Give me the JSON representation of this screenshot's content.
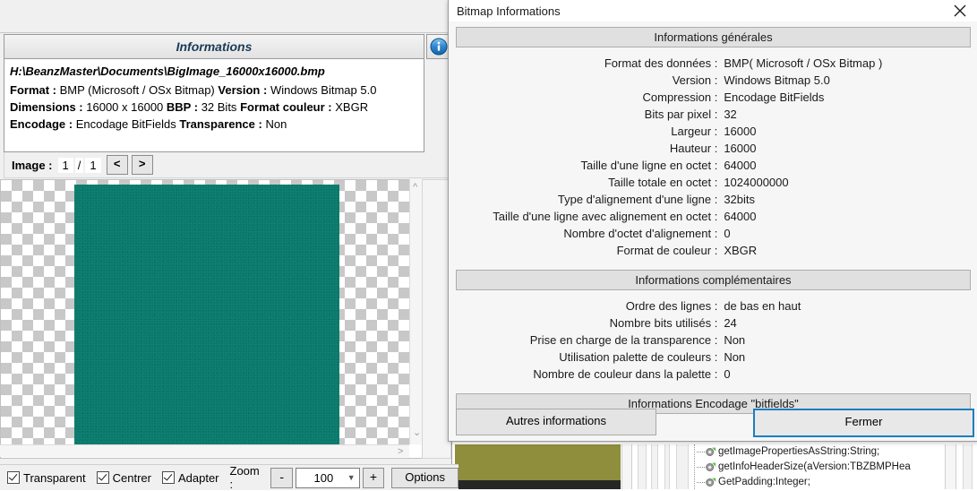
{
  "background": {
    "code_tree": [
      "getImagePropertiesAsString:String;",
      "getInfoHeaderSize(aVersion:TBZBMPHea",
      "GetPadding:Integer;"
    ]
  },
  "main_window": {
    "info_panel": {
      "title": "Informations",
      "file_path": "H:\\BeanzMaster\\Documents\\BigImage_16000x16000.bmp",
      "lines": [
        [
          {
            "k": "Format :",
            "v": "BMP (Microsoft / OSx Bitmap)"
          },
          {
            "k": "Version :",
            "v": "Windows Bitmap 5.0"
          }
        ],
        [
          {
            "k": "Dimensions :",
            "v": "16000 x 16000"
          },
          {
            "k": "BBP :",
            "v": "32 Bits"
          },
          {
            "k": "Format couleur :",
            "v": "XBGR"
          }
        ],
        [
          {
            "k": "Encodage :",
            "v": "Encodage BitFields"
          },
          {
            "k": "Transparence :",
            "v": "Non"
          }
        ]
      ]
    },
    "image_nav": {
      "label": "Image :",
      "current": "1",
      "separator": "/",
      "total": "1",
      "prev": "<",
      "next": ">"
    },
    "bottom_bar": {
      "transparent_label": "Transparent",
      "center_label": "Centrer",
      "adapt_label": "Adapter",
      "zoom_label": "Zoom :",
      "zoom_minus": "-",
      "zoom_value": "100",
      "zoom_plus": "+",
      "options_label": "Options"
    },
    "preview": {
      "image_color": "#0c7a6c"
    }
  },
  "dialog": {
    "title": "Bitmap Informations",
    "close_icon": "close-icon",
    "sections": [
      {
        "heading": "Informations générales",
        "rows": [
          {
            "key": "Format des données :",
            "value": "BMP( Microsoft / OSx Bitmap )"
          },
          {
            "key": "Version :",
            "value": "Windows Bitmap 5.0"
          },
          {
            "key": "Compression :",
            "value": "Encodage BitFields"
          },
          {
            "key": "Bits par pixel :",
            "value": "32"
          },
          {
            "key": "Largeur :",
            "value": "16000"
          },
          {
            "key": "Hauteur :",
            "value": "16000"
          },
          {
            "key": "Taille d'une ligne en octet :",
            "value": "64000"
          },
          {
            "key": "Taille totale en octet :",
            "value": "1024000000"
          },
          {
            "key": "Type d'alignement d'une ligne :",
            "value": "32bits"
          },
          {
            "key": "Taille d'une ligne avec alignement en octet :",
            "value": "64000"
          },
          {
            "key": "Nombre d'octet d'alignement :",
            "value": "0"
          },
          {
            "key": "Format de couleur :",
            "value": "XBGR"
          }
        ]
      },
      {
        "heading": "Informations complémentaires",
        "rows": [
          {
            "key": "Ordre des lignes :",
            "value": "de bas en haut"
          },
          {
            "key": "Nombre bits utilisés :",
            "value": "24"
          },
          {
            "key": "Prise en charge de la transparence :",
            "value": "Non"
          },
          {
            "key": "Utilisation palette de couleurs :",
            "value": "Non"
          },
          {
            "key": "Nombre de couleur dans la palette :",
            "value": "0"
          }
        ]
      },
      {
        "heading": "Informations Encodage \"bitfields\"",
        "rows": []
      }
    ],
    "buttons": {
      "other_info": "Autres informations",
      "close": "Fermer"
    },
    "accent_color": "#1a7fc1"
  }
}
